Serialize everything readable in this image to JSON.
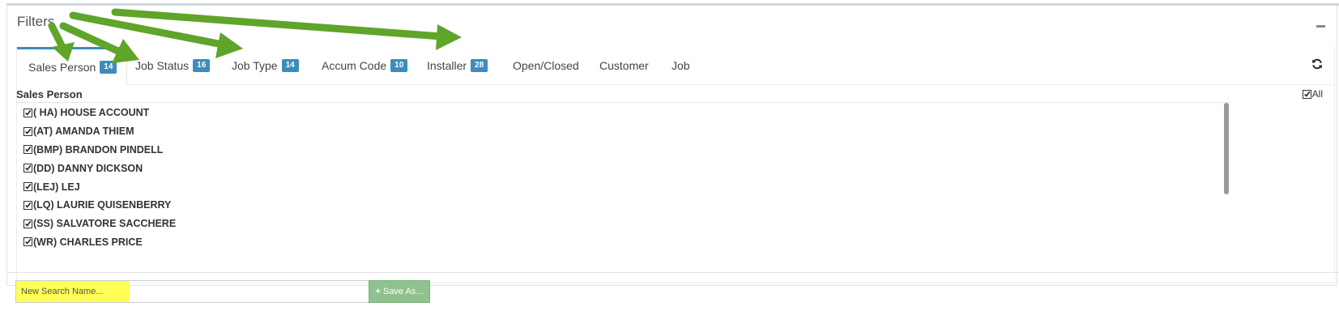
{
  "panel": {
    "title": "Filters"
  },
  "tabs": [
    {
      "label": "Sales Person",
      "badge": "14",
      "active": true
    },
    {
      "label": "Job Status",
      "badge": "16"
    },
    {
      "label": "Job Type",
      "badge": "14"
    },
    {
      "label": "Accum Code",
      "badge": "10"
    },
    {
      "label": "Installer",
      "badge": "28"
    },
    {
      "label": "Open/Closed"
    },
    {
      "label": "Customer"
    },
    {
      "label": "Job"
    }
  ],
  "list": {
    "header": "Sales Person",
    "all_label": "All",
    "items": [
      "( HA) HOUSE ACCOUNT",
      "(AT) AMANDA THIEM",
      "(BMP) BRANDON PINDELL",
      "(DD) DANNY DICKSON",
      "(LEJ) LEJ",
      "(LQ) LAURIE QUISENBERRY",
      "(SS) SALVATORE SACCHERE",
      "(WR) CHARLES PRICE"
    ]
  },
  "search": {
    "placeholder": "New Search Name...",
    "save_label": "Save As..."
  },
  "colors": {
    "accent": "#3c8dbc",
    "annotation_arrow": "#5ea52a",
    "highlight": "#ffff55",
    "save_button": "#8fc28f"
  },
  "icons": {
    "collapse": "minus-icon",
    "refresh": "refresh-icon",
    "checkbox": "checkmark-icon",
    "save": "plus-icon"
  }
}
